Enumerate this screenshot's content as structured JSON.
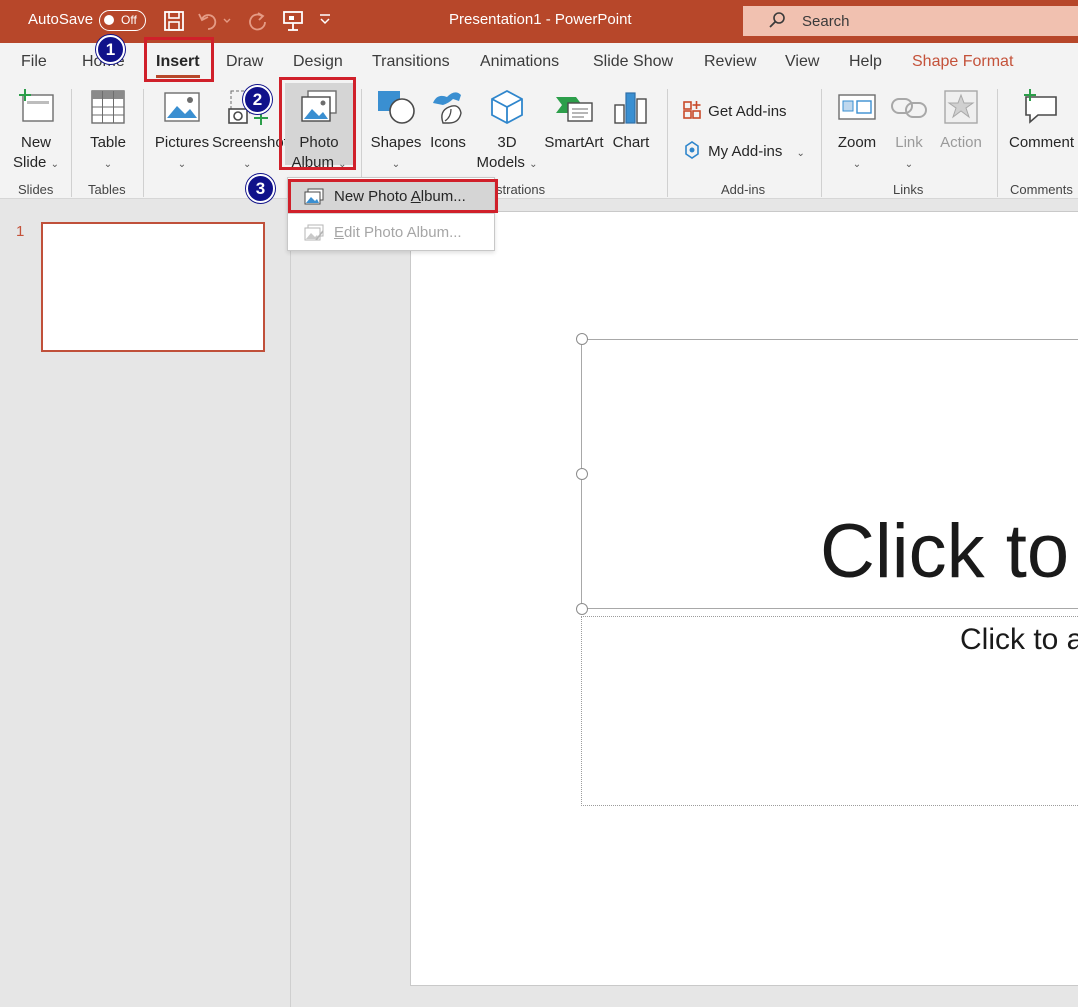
{
  "titlebar": {
    "autosave_label": "AutoSave",
    "autosave_state": "Off",
    "document_title": "Presentation1  -  PowerPoint",
    "search_placeholder": "Search",
    "background_color": "#b7472a"
  },
  "tabs": [
    {
      "label": "File"
    },
    {
      "label": "Home"
    },
    {
      "label": "Insert",
      "active": true
    },
    {
      "label": "Draw"
    },
    {
      "label": "Design"
    },
    {
      "label": "Transitions"
    },
    {
      "label": "Animations"
    },
    {
      "label": "Slide Show"
    },
    {
      "label": "Review"
    },
    {
      "label": "View"
    },
    {
      "label": "Help"
    },
    {
      "label": "Shape Format",
      "accent": true
    }
  ],
  "ribbon": {
    "new_slide": {
      "line1": "New",
      "line2": "Slide"
    },
    "table": "Table",
    "pictures": "Pictures",
    "screenshot": "Screenshot",
    "photo_album": {
      "line1": "Photo",
      "line2": "Album"
    },
    "shapes": "Shapes",
    "icons": "Icons",
    "models_3d": {
      "line1": "3D",
      "line2": "Models"
    },
    "smartart": "SmartArt",
    "chart": "Chart",
    "get_addins": "Get Add-ins",
    "my_addins": "My Add-ins",
    "zoom": "Zoom",
    "link": "Link",
    "action": "Action",
    "comment": "Comment",
    "groups": {
      "slides": "Slides",
      "tables": "Tables",
      "images": "Im",
      "illustrations": "strations",
      "addins": "Add-ins",
      "links": "Links",
      "comments": "Comments"
    }
  },
  "photo_album_menu": {
    "new_prefix": "New Photo ",
    "new_accel": "A",
    "new_suffix": "lbum...",
    "edit_prefix": "",
    "edit_accel": "E",
    "edit_suffix": "dit Photo Album..."
  },
  "thumbnails": [
    {
      "number": "1"
    }
  ],
  "slide": {
    "title_placeholder": "Click to",
    "subtitle_placeholder": "Click to a"
  },
  "callouts": [
    {
      "number": "1",
      "target": "Insert tab"
    },
    {
      "number": "2",
      "target": "Photo Album button"
    },
    {
      "number": "3",
      "target": "New Photo Album menu item"
    }
  ],
  "colors": {
    "accent": "#b7472a",
    "highlight": "#d0202a",
    "badge": "#10128a"
  }
}
